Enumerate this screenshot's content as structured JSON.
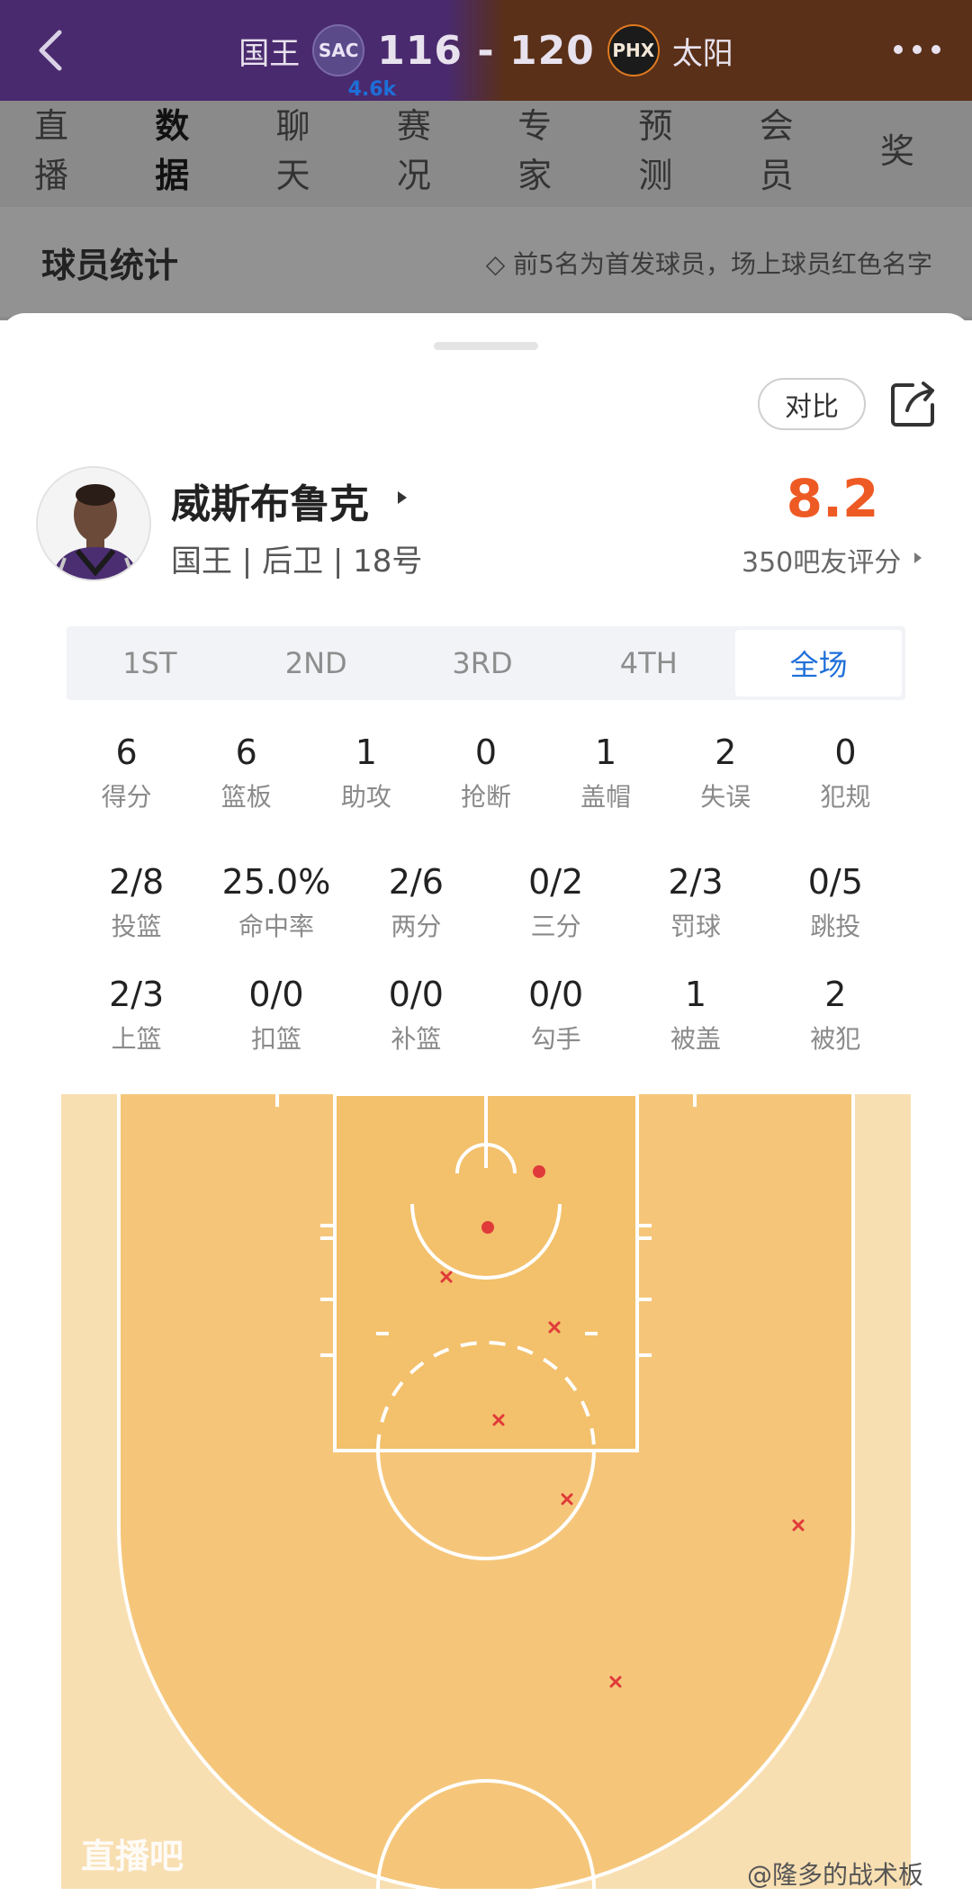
{
  "header": {
    "home_name": "国王",
    "home_abbr": "SAC",
    "score": "116 - 120",
    "away_abbr": "PHX",
    "away_name": "太阳"
  },
  "tabs": [
    {
      "label": "直播"
    },
    {
      "label": "数据",
      "active": true
    },
    {
      "label": "聊天",
      "badge": "4.6k"
    },
    {
      "label": "赛况"
    },
    {
      "label": "专家"
    },
    {
      "label": "预测"
    },
    {
      "label": "会员"
    },
    {
      "label": "奖"
    }
  ],
  "section": {
    "title": "球员统计",
    "note": "◇ 前5名为首发球员，场上球员红色名字"
  },
  "sheet": {
    "compare_label": "对比",
    "player": {
      "name": "威斯布鲁克",
      "info": "国王 | 后卫 | 18号",
      "rating": "8.2",
      "rating_sub": "350吧友评分"
    },
    "quarters": [
      "1ST",
      "2ND",
      "3RD",
      "4TH",
      "全场"
    ],
    "active_quarter": "全场",
    "basic_stats": [
      {
        "value": "6",
        "label": "得分"
      },
      {
        "value": "6",
        "label": "篮板"
      },
      {
        "value": "1",
        "label": "助攻"
      },
      {
        "value": "0",
        "label": "抢断"
      },
      {
        "value": "1",
        "label": "盖帽"
      },
      {
        "value": "2",
        "label": "失误"
      },
      {
        "value": "0",
        "label": "犯规"
      }
    ],
    "shooting_stats": [
      {
        "value": "2/8",
        "label": "投篮"
      },
      {
        "value": "25.0%",
        "label": "命中率"
      },
      {
        "value": "2/6",
        "label": "两分"
      },
      {
        "value": "0/2",
        "label": "三分"
      },
      {
        "value": "2/3",
        "label": "罚球"
      },
      {
        "value": "0/5",
        "label": "跳投"
      }
    ],
    "shot_type_stats": [
      {
        "value": "2/3",
        "label": "上篮"
      },
      {
        "value": "0/0",
        "label": "扣篮"
      },
      {
        "value": "0/0",
        "label": "补篮"
      },
      {
        "value": "0/0",
        "label": "勾手"
      },
      {
        "value": "1",
        "label": "被盖"
      },
      {
        "value": "2",
        "label": "被犯"
      }
    ]
  },
  "shot_chart": {
    "made_color": "#e03a3a",
    "missed_color": "#e03a3a",
    "made": 2,
    "missed": 7
  },
  "watermark": "直播吧",
  "credit": "@隆多的战术板"
}
